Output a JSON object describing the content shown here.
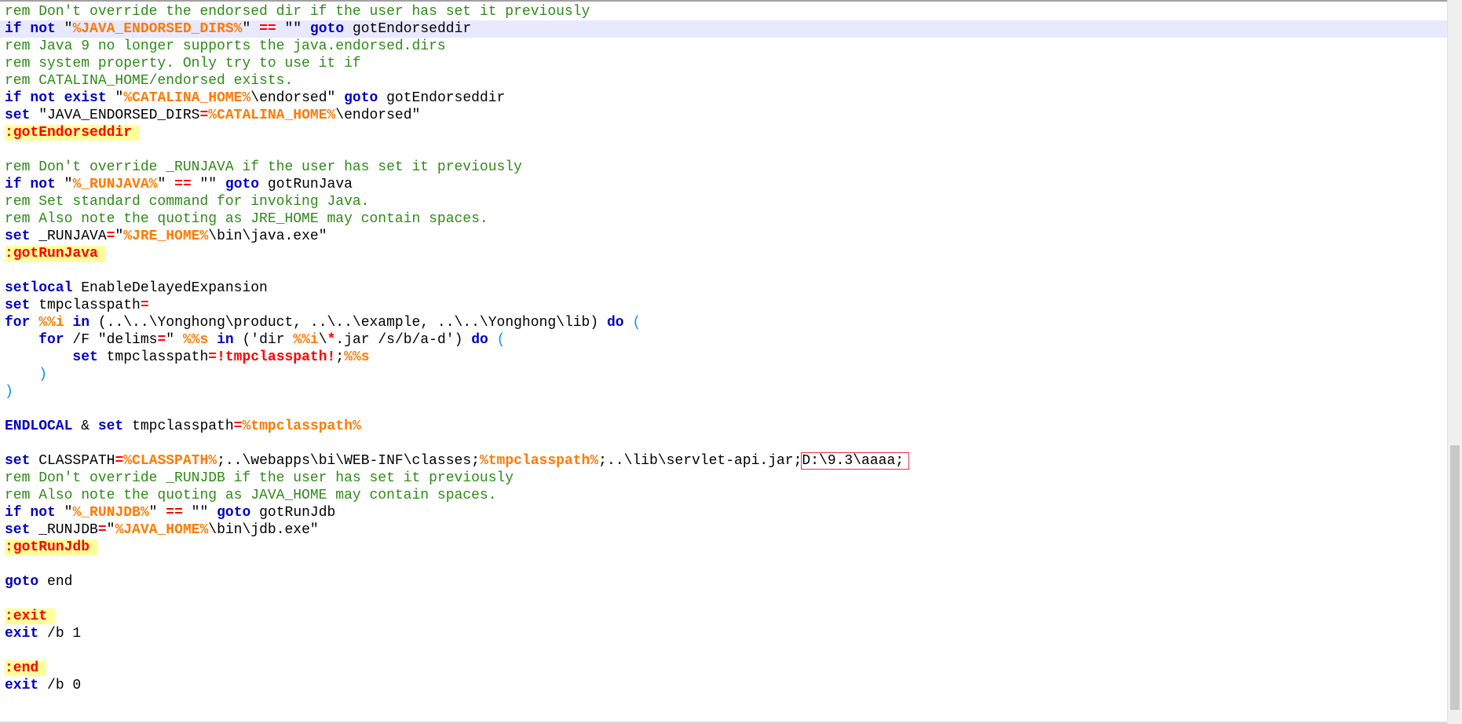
{
  "editor": {
    "lines": [
      [
        {
          "t": "rem Don't override the endorsed dir if the user has set it previously",
          "c": "rem"
        }
      ],
      [
        {
          "t": "if not ",
          "c": "kw"
        },
        {
          "t": "\"",
          "c": ""
        },
        {
          "t": "%JAVA_ENDORSED_DIRS%",
          "c": "var"
        },
        {
          "t": "\" ",
          "c": ""
        },
        {
          "t": "==",
          "c": "op"
        },
        {
          "t": " \"\" ",
          "c": ""
        },
        {
          "t": "goto",
          "c": "kw"
        },
        {
          "t": " gotEndorseddir",
          "c": ""
        }
      ],
      [
        {
          "t": "rem Java 9 no longer supports the java.endorsed.dirs",
          "c": "rem"
        }
      ],
      [
        {
          "t": "rem system property. Only try to use it if",
          "c": "rem"
        }
      ],
      [
        {
          "t": "rem CATALINA_HOME/endorsed exists.",
          "c": "rem"
        }
      ],
      [
        {
          "t": "if not exist ",
          "c": "kw"
        },
        {
          "t": "\"",
          "c": ""
        },
        {
          "t": "%CATALINA_HOME%",
          "c": "var"
        },
        {
          "t": "\\endorsed\" ",
          "c": ""
        },
        {
          "t": "goto",
          "c": "kw"
        },
        {
          "t": " gotEndorseddir",
          "c": ""
        }
      ],
      [
        {
          "t": "set",
          "c": "kw"
        },
        {
          "t": " \"JAVA_ENDORSED_DIRS",
          "c": ""
        },
        {
          "t": "=",
          "c": "op"
        },
        {
          "t": "%CATALINA_HOME%",
          "c": "var"
        },
        {
          "t": "\\endorsed\"",
          "c": ""
        }
      ],
      [
        {
          "t": ":gotEndorseddir",
          "c": "label"
        }
      ],
      [],
      [
        {
          "t": "rem Don't override _RUNJAVA if the user has set it previously",
          "c": "rem"
        }
      ],
      [
        {
          "t": "if not ",
          "c": "kw"
        },
        {
          "t": "\"",
          "c": ""
        },
        {
          "t": "%_RUNJAVA%",
          "c": "var"
        },
        {
          "t": "\" ",
          "c": ""
        },
        {
          "t": "==",
          "c": "op"
        },
        {
          "t": " \"\" ",
          "c": ""
        },
        {
          "t": "goto",
          "c": "kw"
        },
        {
          "t": " gotRunJava",
          "c": ""
        }
      ],
      [
        {
          "t": "rem Set standard command for invoking Java.",
          "c": "rem"
        }
      ],
      [
        {
          "t": "rem Also note the quoting as JRE_HOME may contain spaces.",
          "c": "rem"
        }
      ],
      [
        {
          "t": "set",
          "c": "kw"
        },
        {
          "t": " _RUNJAVA",
          "c": ""
        },
        {
          "t": "=",
          "c": "op"
        },
        {
          "t": "\"",
          "c": ""
        },
        {
          "t": "%JRE_HOME%",
          "c": "var"
        },
        {
          "t": "\\bin\\java.exe\"",
          "c": ""
        }
      ],
      [
        {
          "t": ":gotRunJava",
          "c": "label"
        }
      ],
      [],
      [
        {
          "t": "setlocal",
          "c": "kw"
        },
        {
          "t": " EnableDelayedExpansion",
          "c": ""
        }
      ],
      [
        {
          "t": "set",
          "c": "kw"
        },
        {
          "t": " tmpclasspath",
          "c": ""
        },
        {
          "t": "=",
          "c": "op"
        }
      ],
      [
        {
          "t": "for",
          "c": "kw"
        },
        {
          "t": " ",
          "c": ""
        },
        {
          "t": "%%i",
          "c": "var"
        },
        {
          "t": " ",
          "c": ""
        },
        {
          "t": "in",
          "c": "kw"
        },
        {
          "t": " (..\\..\\Yonghong\\product, ..\\..\\example, ..\\..\\Yonghong\\lib) ",
          "c": ""
        },
        {
          "t": "do",
          "c": "kw"
        },
        {
          "t": " ",
          "c": ""
        },
        {
          "t": "(",
          "c": "par"
        }
      ],
      [
        {
          "t": "    ",
          "c": ""
        },
        {
          "t": "for",
          "c": "kw"
        },
        {
          "t": " /F \"delims",
          "c": ""
        },
        {
          "t": "=",
          "c": "op"
        },
        {
          "t": "\" ",
          "c": ""
        },
        {
          "t": "%%s",
          "c": "var"
        },
        {
          "t": " ",
          "c": ""
        },
        {
          "t": "in",
          "c": "kw"
        },
        {
          "t": " ('dir ",
          "c": ""
        },
        {
          "t": "%%i",
          "c": "var"
        },
        {
          "t": "\\",
          "c": ""
        },
        {
          "t": "*",
          "c": "op"
        },
        {
          "t": ".jar /s/b/a-d') ",
          "c": ""
        },
        {
          "t": "do",
          "c": "kw"
        },
        {
          "t": " ",
          "c": ""
        },
        {
          "t": "(",
          "c": "par"
        }
      ],
      [
        {
          "t": "        ",
          "c": ""
        },
        {
          "t": "set",
          "c": "kw"
        },
        {
          "t": " tmpclasspath",
          "c": ""
        },
        {
          "t": "=",
          "c": "op"
        },
        {
          "t": "!tmpclasspath!",
          "c": "op"
        },
        {
          "t": ";",
          "c": ""
        },
        {
          "t": "%%s",
          "c": "var"
        }
      ],
      [
        {
          "t": "    ",
          "c": ""
        },
        {
          "t": ")",
          "c": "par"
        }
      ],
      [
        {
          "t": ")",
          "c": "par"
        }
      ],
      [],
      [
        {
          "t": "ENDLOCAL",
          "c": "kw"
        },
        {
          "t": " & ",
          "c": ""
        },
        {
          "t": "set",
          "c": "kw"
        },
        {
          "t": " tmpclasspath",
          "c": ""
        },
        {
          "t": "=",
          "c": "op"
        },
        {
          "t": "%tmpclasspath%",
          "c": "var"
        }
      ],
      [],
      [
        {
          "t": "set",
          "c": "kw"
        },
        {
          "t": " CLASSPATH",
          "c": ""
        },
        {
          "t": "=",
          "c": "op"
        },
        {
          "t": "%CLASSPATH%",
          "c": "var"
        },
        {
          "t": ";..\\webapps\\bi\\WEB-INF\\classes;",
          "c": ""
        },
        {
          "t": "%tmpclasspath%",
          "c": "var"
        },
        {
          "t": ";..\\lib\\servlet-api.jar;",
          "c": ""
        },
        {
          "t": "D:\\9.3\\aaaa;",
          "c": "boxed"
        }
      ],
      [
        {
          "t": "rem Don't override _RUNJDB if the user has set it previously",
          "c": "rem"
        }
      ],
      [
        {
          "t": "rem Also note the quoting as JAVA_HOME may contain spaces.",
          "c": "rem"
        }
      ],
      [
        {
          "t": "if not ",
          "c": "kw"
        },
        {
          "t": "\"",
          "c": ""
        },
        {
          "t": "%_RUNJDB%",
          "c": "var"
        },
        {
          "t": "\" ",
          "c": ""
        },
        {
          "t": "==",
          "c": "op"
        },
        {
          "t": " \"\" ",
          "c": ""
        },
        {
          "t": "goto",
          "c": "kw"
        },
        {
          "t": " gotRunJdb",
          "c": ""
        }
      ],
      [
        {
          "t": "set",
          "c": "kw"
        },
        {
          "t": " _RUNJDB",
          "c": ""
        },
        {
          "t": "=",
          "c": "op"
        },
        {
          "t": "\"",
          "c": ""
        },
        {
          "t": "%JAVA_HOME%",
          "c": "var"
        },
        {
          "t": "\\bin\\jdb.exe\"",
          "c": ""
        }
      ],
      [
        {
          "t": ":gotRunJdb",
          "c": "label"
        }
      ],
      [],
      [
        {
          "t": "goto",
          "c": "kw"
        },
        {
          "t": " end",
          "c": ""
        }
      ],
      [],
      [
        {
          "t": ":exit",
          "c": "label"
        }
      ],
      [
        {
          "t": "exit",
          "c": "kw"
        },
        {
          "t": " /b 1",
          "c": ""
        }
      ],
      [],
      [
        {
          "t": ":end",
          "c": "label"
        }
      ],
      [
        {
          "t": "exit",
          "c": "kw"
        },
        {
          "t": " /b 0",
          "c": ""
        }
      ]
    ],
    "current_line_index": 1
  },
  "colors": {
    "comment": "#2e8b17",
    "keyword": "#0000c8",
    "variable": "#ff7a00",
    "operator": "#ff0000",
    "label_background": "#ffff99",
    "current_line": "#e8e8ff",
    "annotation_box": "#e8303a"
  }
}
